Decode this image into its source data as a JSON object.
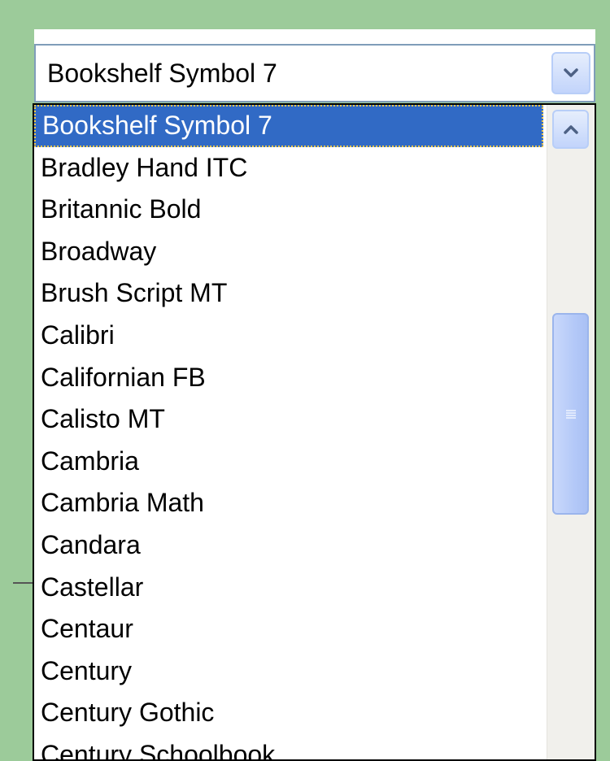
{
  "combo": {
    "value": "Bookshelf Symbol 7",
    "button_icon": "chevron-down-icon"
  },
  "dropdown": {
    "items": [
      {
        "label": "Bookshelf Symbol 7",
        "selected": true
      },
      {
        "label": "Bradley Hand ITC"
      },
      {
        "label": "Britannic Bold"
      },
      {
        "label": "Broadway"
      },
      {
        "label": "Brush Script MT"
      },
      {
        "label": "Calibri"
      },
      {
        "label": "Californian FB"
      },
      {
        "label": "Calisto MT"
      },
      {
        "label": "Cambria"
      },
      {
        "label": "Cambria Math"
      },
      {
        "label": "Candara"
      },
      {
        "label": "Castellar"
      },
      {
        "label": "Centaur"
      },
      {
        "label": "Century"
      },
      {
        "label": "Century Gothic"
      },
      {
        "label": "Century Schoolbook"
      }
    ],
    "scrollbar": {
      "up_icon": "chevron-up-icon",
      "thumb_grip_icon": "grip-icon"
    }
  },
  "colors": {
    "background": "#9ccb9a",
    "selection": "#316ac5",
    "focus_border": "#f2c94c",
    "scroll_button": "#c2d4fb"
  }
}
